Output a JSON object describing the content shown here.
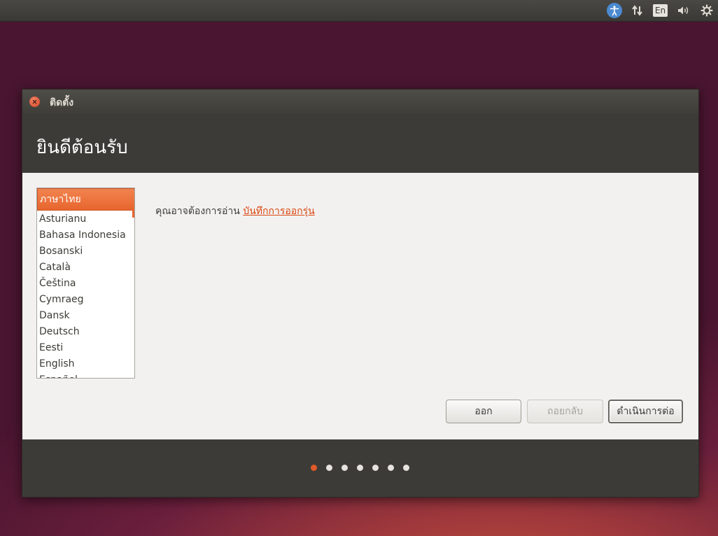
{
  "topbar": {
    "tray": [
      {
        "icon": "accessibility-icon"
      },
      {
        "icon": "network-icon"
      },
      {
        "icon": "keyboard-layout-icon",
        "label": "En"
      },
      {
        "icon": "volume-icon"
      },
      {
        "icon": "settings-gear-icon"
      }
    ]
  },
  "window": {
    "title": "ติดตั้ง",
    "heading": "ยินดีต้อนรับ",
    "languages": {
      "selected": "ภาษาไทย",
      "items": [
        "Asturianu",
        "Bahasa Indonesia",
        "Bosanski",
        "Català",
        "Čeština",
        "Cymraeg",
        "Dansk",
        "Deutsch",
        "Eesti",
        "English",
        "Español"
      ]
    },
    "notes_prefix": "คุณอาจต้องการอ่าน",
    "notes_link": "บันทึกการออกรุ่น",
    "buttons": {
      "quit": "ออก",
      "back": "ถอยกลับ",
      "continue": "ดำเนินการต่อ"
    },
    "progress": {
      "total_steps": 7,
      "current_step": 1
    },
    "colors": {
      "accent": "#e05a2a",
      "header_bg": "#3c3b37"
    }
  }
}
